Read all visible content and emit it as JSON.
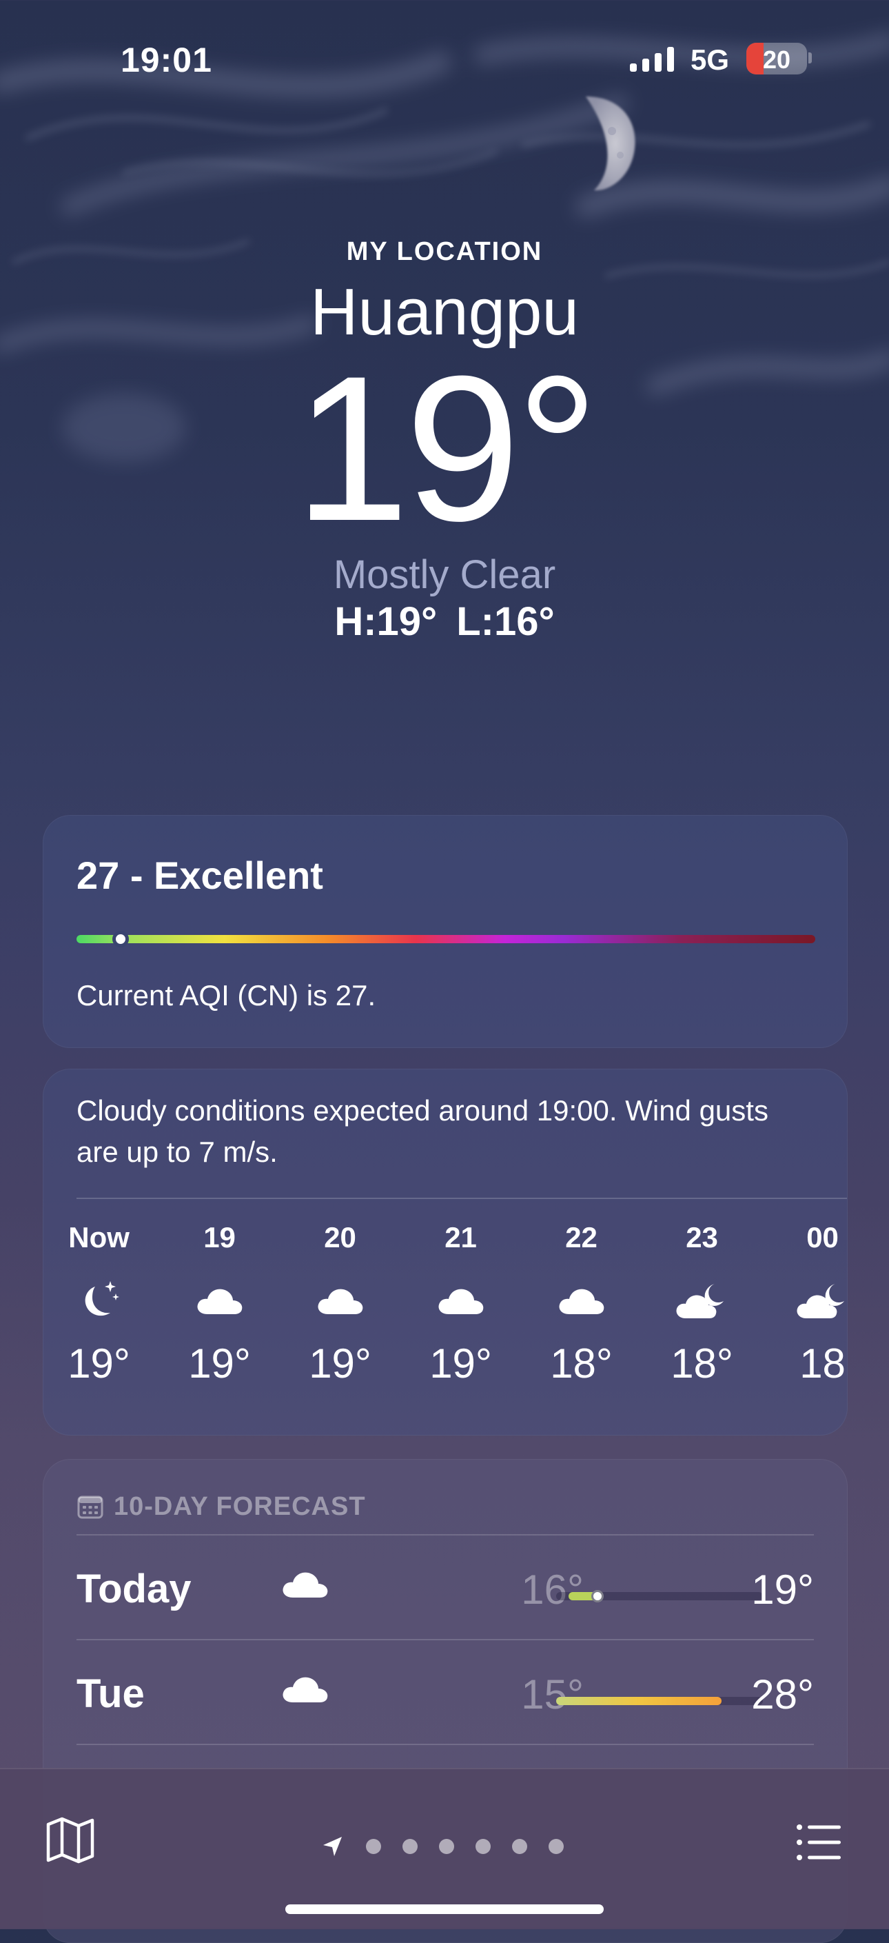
{
  "status_bar": {
    "time": "19:01",
    "network": "5G",
    "battery_level": 20,
    "battery_text": "20",
    "battery_color": "#e5443a"
  },
  "header": {
    "location_caption": "MY LOCATION",
    "city": "Huangpu",
    "temperature": "19°",
    "condition": "Mostly Clear",
    "high": "H:19°",
    "low": "L:16°"
  },
  "air_quality": {
    "title": "27 - Excellent",
    "description": "Current AQI (CN) is 27.",
    "indicator_fraction": 0.06
  },
  "hourly": {
    "summary": "Cloudy conditions expected around 19:00. Wind gusts are up to 7 m/s.",
    "items": [
      {
        "label": "Now",
        "icon": "moon-stars-icon",
        "temp": "19°"
      },
      {
        "label": "19",
        "icon": "cloud-icon",
        "temp": "19°"
      },
      {
        "label": "20",
        "icon": "cloud-icon",
        "temp": "19°"
      },
      {
        "label": "21",
        "icon": "cloud-icon",
        "temp": "19°"
      },
      {
        "label": "22",
        "icon": "cloud-icon",
        "temp": "18°"
      },
      {
        "label": "23",
        "icon": "cloud-moon-icon",
        "temp": "18°"
      },
      {
        "label": "00",
        "icon": "cloud-moon-icon",
        "temp": "18"
      }
    ]
  },
  "forecast": {
    "title": "10-DAY FORECAST",
    "icon": "calendar-icon",
    "days": [
      {
        "day": "Today",
        "icon": "cloud-icon",
        "low": "16°",
        "high": "19°",
        "range_start": 0.06,
        "range_end": 0.2,
        "current_fraction": 0.2,
        "range_color": "#b9d35a"
      },
      {
        "day": "Tue",
        "icon": "cloud-icon",
        "low": "15°",
        "high": "28°",
        "range_start": 0.0,
        "range_end": 0.8,
        "current_fraction": null,
        "range_color": "linear-gradient(90deg,#c9d67a,#f1c542,#f4a13a)"
      }
    ]
  },
  "toolbar": {
    "map_icon": "map-icon",
    "location_icon": "location-arrow-icon",
    "page_count": 6,
    "list_icon": "list-icon"
  }
}
